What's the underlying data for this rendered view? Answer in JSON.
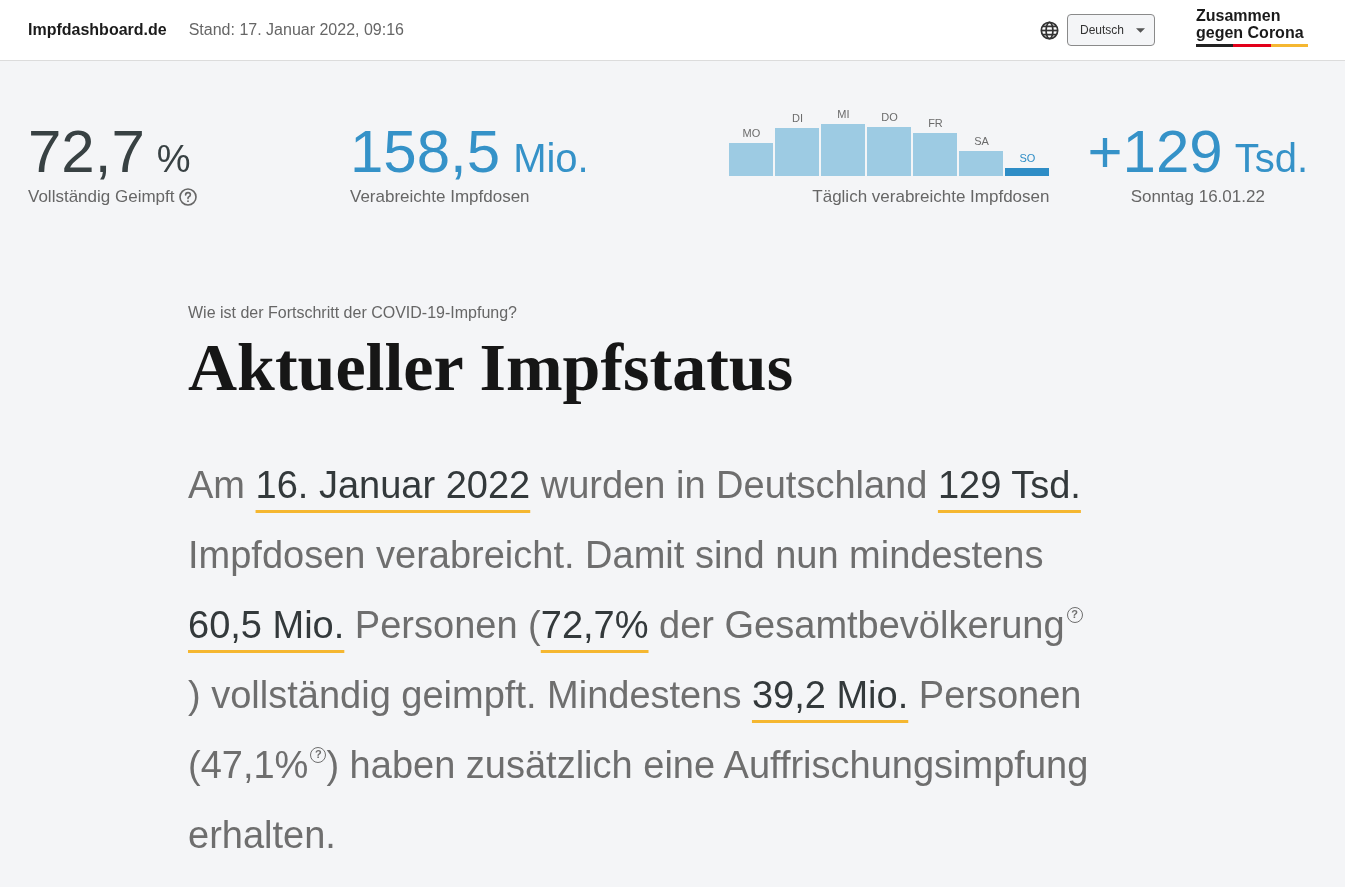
{
  "header": {
    "site_title": "Impfdashboard.de",
    "timestamp": "Stand: 17. Januar 2022, 09:16",
    "language_select": {
      "value": "Deutsch"
    },
    "logo": "Zusammen gegen Corona"
  },
  "vaccinated_share": {
    "value": "72,7",
    "unit": "%",
    "label": "Vollständig Geimpft"
  },
  "doses_total": {
    "value": "158,5",
    "unit": "Mio.",
    "label": "Verabreichte Impfdosen"
  },
  "daily_chart": {
    "days": [
      {
        "label": "MO",
        "selected": false
      },
      {
        "label": "DI",
        "selected": false
      },
      {
        "label": "MI",
        "selected": false
      },
      {
        "label": "DO",
        "selected": false
      },
      {
        "label": "FR",
        "selected": false
      },
      {
        "label": "SA",
        "selected": false
      },
      {
        "label": "SO",
        "selected": true
      }
    ],
    "caption": "Täglich verabreichte Impfdosen"
  },
  "latest_day": {
    "value": "+129",
    "unit": "Tsd.",
    "label": "Sonntag 16.01.22"
  },
  "status_section": {
    "kicker": "Wie ist der Fortschritt der COVID-19-Impfung?",
    "title": "Aktueller Impfstatus",
    "summary": [
      {
        "text": "Am ",
        "highlighted": false
      },
      {
        "text": "16. Januar 2022",
        "highlighted": true
      },
      {
        "text": " wurden in Deutschland ",
        "highlighted": false
      },
      {
        "text": "129 Tsd.",
        "highlighted": true
      },
      {
        "text": " Impfdosen verabreicht. Damit sind nun mindestens ",
        "highlighted": false
      },
      {
        "text": "60,5 Mio.",
        "highlighted": true
      },
      {
        "text": " Personen (",
        "highlighted": false
      },
      {
        "text": "72,7%",
        "highlighted": true
      },
      {
        "text": " der Gesamtbevölkerung$^{?}$) vollständig geimpft. Mindestens ",
        "highlighted": false
      },
      {
        "text": "39,2 Mio.",
        "highlighted": true
      },
      {
        "text": " Personen (47,1%$^{?}$) haben zusätzlich eine Auffrischungsimpfung erhalten.",
        "highlighted": false
      }
    ]
  }
}
